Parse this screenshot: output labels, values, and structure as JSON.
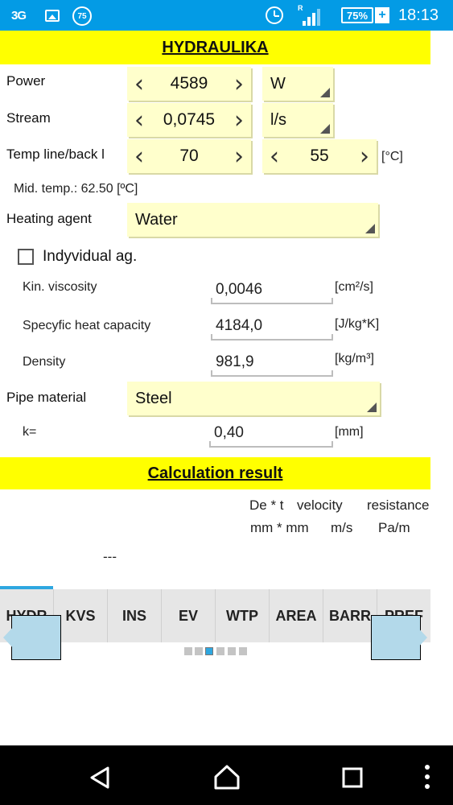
{
  "status_bar": {
    "network": "3G",
    "notif_badge": "75",
    "roaming": "R",
    "battery": "75%",
    "charging": "+",
    "time": "18:13"
  },
  "header": {
    "title": "HYDRAULIKA"
  },
  "power": {
    "label": "Power",
    "value": "4589",
    "unit": "W"
  },
  "stream": {
    "label": "Stream",
    "value": "0,0745",
    "unit": "l/s"
  },
  "temp": {
    "label": "Temp line/back l",
    "line": "70",
    "back": "55",
    "unit": "[°C]"
  },
  "mid_temp": {
    "text": "Mid. temp.:  62.50 [ºC]"
  },
  "heating_agent": {
    "label": "Heating agent",
    "value": "Water"
  },
  "individual": {
    "label": "Indyvidual ag.",
    "checked": false
  },
  "viscosity": {
    "label": "Kin. viscosity",
    "value": "0,0046",
    "unit": "[cm²/s]"
  },
  "heat_capacity": {
    "label": "Specyfic heat capacity",
    "value": "4184,0",
    "unit": "[J/kg*K]"
  },
  "density": {
    "label": "Density",
    "value": "981,9",
    "unit": "[kg/m³]"
  },
  "pipe_material": {
    "label": "Pipe material",
    "value": "Steel"
  },
  "k": {
    "label": "k=",
    "value": "0,40",
    "unit": "[mm]"
  },
  "result": {
    "title": "Calculation result",
    "col1_head": "De * t",
    "col1_unit": "mm * mm",
    "col2_head": "velocity",
    "col2_unit": "m/s",
    "col3_head": "resistance",
    "col3_unit": "Pa/m",
    "placeholder": "---"
  },
  "tabs": [
    "HYDR",
    "KVS",
    "INS",
    "EV",
    "WTP",
    "AREA",
    "BARR",
    "PREF"
  ],
  "colors": {
    "status_bar": "#039be5",
    "header": "#ffff00",
    "field": "#ffffcc",
    "accent": "#2ea7e0"
  },
  "icons": [
    "image-icon",
    "badge-icon",
    "alarm-icon",
    "signal-icon",
    "battery-icon",
    "back-icon",
    "home-icon",
    "recents-icon",
    "more-icon"
  ]
}
